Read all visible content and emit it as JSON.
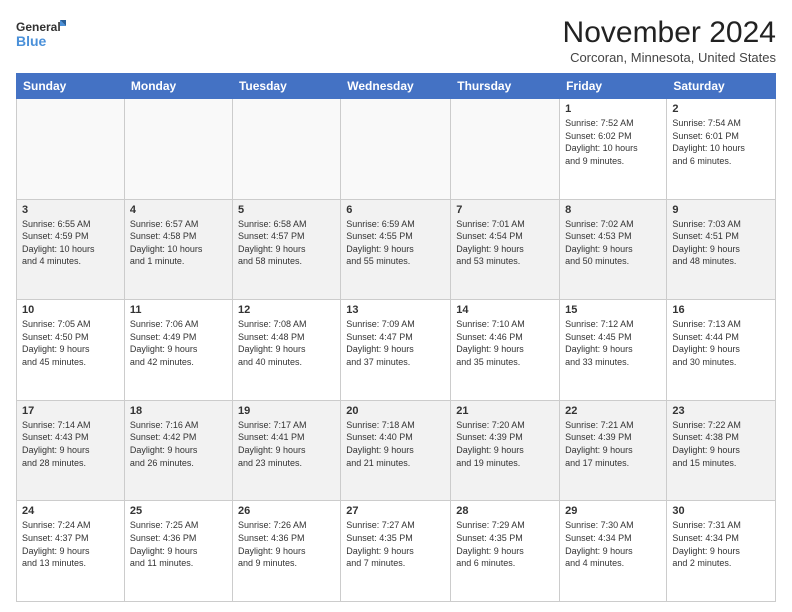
{
  "header": {
    "logo_line1": "General",
    "logo_line2": "Blue",
    "month": "November 2024",
    "location": "Corcoran, Minnesota, United States"
  },
  "weekdays": [
    "Sunday",
    "Monday",
    "Tuesday",
    "Wednesday",
    "Thursday",
    "Friday",
    "Saturday"
  ],
  "weeks": [
    [
      {
        "day": "",
        "info": ""
      },
      {
        "day": "",
        "info": ""
      },
      {
        "day": "",
        "info": ""
      },
      {
        "day": "",
        "info": ""
      },
      {
        "day": "",
        "info": ""
      },
      {
        "day": "1",
        "info": "Sunrise: 7:52 AM\nSunset: 6:02 PM\nDaylight: 10 hours\nand 9 minutes."
      },
      {
        "day": "2",
        "info": "Sunrise: 7:54 AM\nSunset: 6:01 PM\nDaylight: 10 hours\nand 6 minutes."
      }
    ],
    [
      {
        "day": "3",
        "info": "Sunrise: 6:55 AM\nSunset: 4:59 PM\nDaylight: 10 hours\nand 4 minutes."
      },
      {
        "day": "4",
        "info": "Sunrise: 6:57 AM\nSunset: 4:58 PM\nDaylight: 10 hours\nand 1 minute."
      },
      {
        "day": "5",
        "info": "Sunrise: 6:58 AM\nSunset: 4:57 PM\nDaylight: 9 hours\nand 58 minutes."
      },
      {
        "day": "6",
        "info": "Sunrise: 6:59 AM\nSunset: 4:55 PM\nDaylight: 9 hours\nand 55 minutes."
      },
      {
        "day": "7",
        "info": "Sunrise: 7:01 AM\nSunset: 4:54 PM\nDaylight: 9 hours\nand 53 minutes."
      },
      {
        "day": "8",
        "info": "Sunrise: 7:02 AM\nSunset: 4:53 PM\nDaylight: 9 hours\nand 50 minutes."
      },
      {
        "day": "9",
        "info": "Sunrise: 7:03 AM\nSunset: 4:51 PM\nDaylight: 9 hours\nand 48 minutes."
      }
    ],
    [
      {
        "day": "10",
        "info": "Sunrise: 7:05 AM\nSunset: 4:50 PM\nDaylight: 9 hours\nand 45 minutes."
      },
      {
        "day": "11",
        "info": "Sunrise: 7:06 AM\nSunset: 4:49 PM\nDaylight: 9 hours\nand 42 minutes."
      },
      {
        "day": "12",
        "info": "Sunrise: 7:08 AM\nSunset: 4:48 PM\nDaylight: 9 hours\nand 40 minutes."
      },
      {
        "day": "13",
        "info": "Sunrise: 7:09 AM\nSunset: 4:47 PM\nDaylight: 9 hours\nand 37 minutes."
      },
      {
        "day": "14",
        "info": "Sunrise: 7:10 AM\nSunset: 4:46 PM\nDaylight: 9 hours\nand 35 minutes."
      },
      {
        "day": "15",
        "info": "Sunrise: 7:12 AM\nSunset: 4:45 PM\nDaylight: 9 hours\nand 33 minutes."
      },
      {
        "day": "16",
        "info": "Sunrise: 7:13 AM\nSunset: 4:44 PM\nDaylight: 9 hours\nand 30 minutes."
      }
    ],
    [
      {
        "day": "17",
        "info": "Sunrise: 7:14 AM\nSunset: 4:43 PM\nDaylight: 9 hours\nand 28 minutes."
      },
      {
        "day": "18",
        "info": "Sunrise: 7:16 AM\nSunset: 4:42 PM\nDaylight: 9 hours\nand 26 minutes."
      },
      {
        "day": "19",
        "info": "Sunrise: 7:17 AM\nSunset: 4:41 PM\nDaylight: 9 hours\nand 23 minutes."
      },
      {
        "day": "20",
        "info": "Sunrise: 7:18 AM\nSunset: 4:40 PM\nDaylight: 9 hours\nand 21 minutes."
      },
      {
        "day": "21",
        "info": "Sunrise: 7:20 AM\nSunset: 4:39 PM\nDaylight: 9 hours\nand 19 minutes."
      },
      {
        "day": "22",
        "info": "Sunrise: 7:21 AM\nSunset: 4:39 PM\nDaylight: 9 hours\nand 17 minutes."
      },
      {
        "day": "23",
        "info": "Sunrise: 7:22 AM\nSunset: 4:38 PM\nDaylight: 9 hours\nand 15 minutes."
      }
    ],
    [
      {
        "day": "24",
        "info": "Sunrise: 7:24 AM\nSunset: 4:37 PM\nDaylight: 9 hours\nand 13 minutes."
      },
      {
        "day": "25",
        "info": "Sunrise: 7:25 AM\nSunset: 4:36 PM\nDaylight: 9 hours\nand 11 minutes."
      },
      {
        "day": "26",
        "info": "Sunrise: 7:26 AM\nSunset: 4:36 PM\nDaylight: 9 hours\nand 9 minutes."
      },
      {
        "day": "27",
        "info": "Sunrise: 7:27 AM\nSunset: 4:35 PM\nDaylight: 9 hours\nand 7 minutes."
      },
      {
        "day": "28",
        "info": "Sunrise: 7:29 AM\nSunset: 4:35 PM\nDaylight: 9 hours\nand 6 minutes."
      },
      {
        "day": "29",
        "info": "Sunrise: 7:30 AM\nSunset: 4:34 PM\nDaylight: 9 hours\nand 4 minutes."
      },
      {
        "day": "30",
        "info": "Sunrise: 7:31 AM\nSunset: 4:34 PM\nDaylight: 9 hours\nand 2 minutes."
      }
    ]
  ]
}
